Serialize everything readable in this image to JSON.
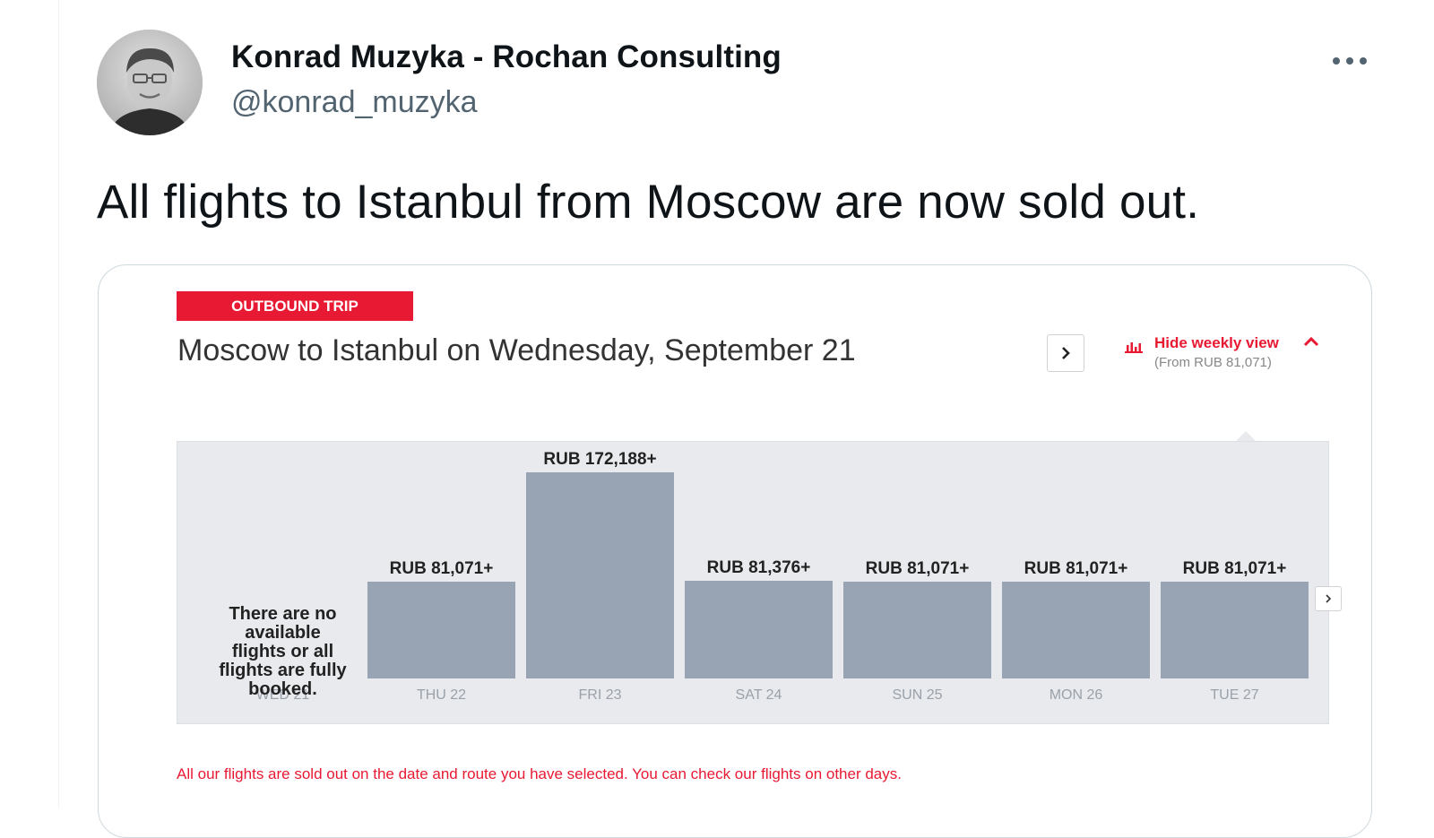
{
  "tweet": {
    "author_name": "Konrad Muzyka - Rochan Consulting",
    "handle": "@konrad_muzyka",
    "text": "All flights to Istanbul from Moscow are now sold out.",
    "more_icon": "more-horizontal-icon"
  },
  "booking": {
    "trip_badge": "OUTBOUND TRIP",
    "route_title": "Moscow to Istanbul on Wednesday, September 21",
    "next_day_icon": "chevron-right-icon",
    "weekly_toggle": {
      "label": "Hide weekly view",
      "from_price": "(From RUB 81,071)",
      "icon": "bar-chart-icon",
      "caret_icon": "chevron-up-icon"
    },
    "no_flights_message": "There are no available flights or all flights are fully booked.",
    "sold_out_note": "All our flights are sold out on the date and route you have selected. You can check our flights on other days.",
    "colors": {
      "accent": "#e81932",
      "bar": "#98a3b3",
      "panel": "#e8eaed"
    }
  },
  "chart_data": {
    "type": "bar",
    "categories": [
      "WED 21",
      "THU 22",
      "FRI 23",
      "SAT 24",
      "SUN 25",
      "MON 26",
      "TUE 27"
    ],
    "values": [
      null,
      81071,
      172188,
      81376,
      81071,
      81071,
      81071
    ],
    "value_labels": [
      "",
      "RUB 81,071+",
      "RUB 172,188+",
      "RUB 81,376+",
      "RUB 81,071+",
      "RUB 81,071+",
      "RUB 81,071+"
    ],
    "title": "",
    "xlabel": "",
    "ylabel": ""
  }
}
